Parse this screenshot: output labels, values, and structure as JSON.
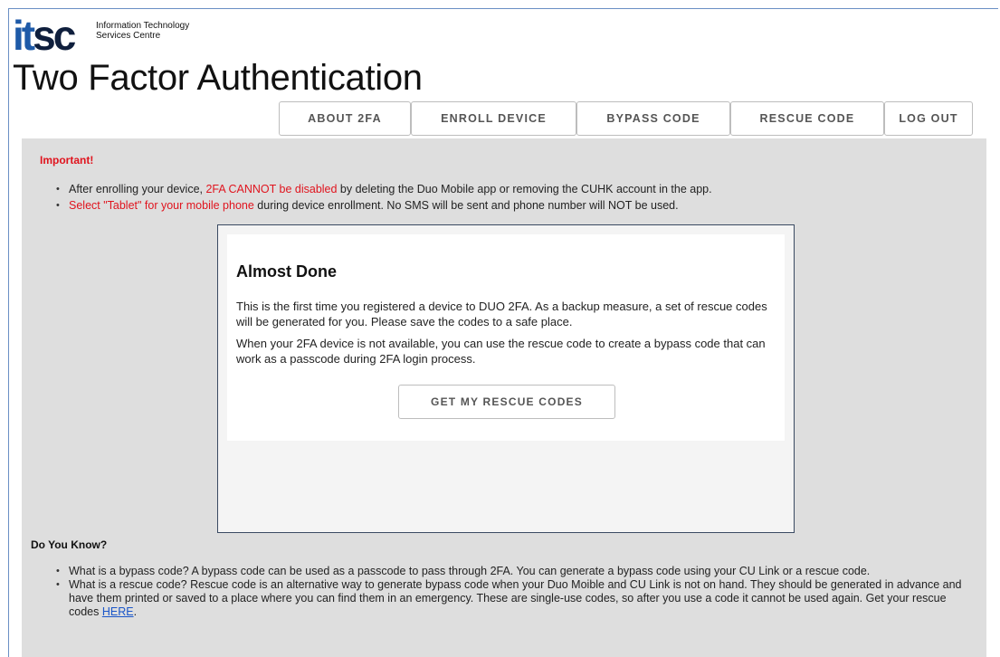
{
  "logo": {
    "mark": {
      "i": "i",
      "t": "t",
      "sc": "sc"
    },
    "line1": "Information Technology",
    "line2": "Services Centre"
  },
  "page_title": "Two Factor Authentication",
  "nav": [
    {
      "label": "ABOUT 2FA"
    },
    {
      "label": "ENROLL DEVICE"
    },
    {
      "label": "BYPASS CODE"
    },
    {
      "label": "RESCUE CODE"
    },
    {
      "label": "LOG OUT"
    }
  ],
  "important": {
    "heading": "Important!",
    "item1": {
      "pre": "After enrolling your device, ",
      "red": "2FA CANNOT be disabled",
      "post": " by deleting the Duo Mobile app or removing the CUHK account in the app."
    },
    "item2": {
      "red": "Select \"Tablet\" for your mobile phone",
      "post": " during device enrollment. No SMS will be sent and phone number will NOT be used."
    }
  },
  "modal": {
    "title": "Almost Done",
    "p1": "This is the first time you registered a device to DUO 2FA. As a backup measure, a set of rescue codes will be generated for you. Please save the codes to a safe place.",
    "p2": "When your 2FA device is not available, you can use the rescue code to create a bypass code that can work as a passcode during 2FA login process.",
    "button": "GET MY RESCUE CODES"
  },
  "do_you_know": {
    "heading": "Do You Know?",
    "item1": "What is a bypass code? A bypass code can be used as a passcode to pass through 2FA. You can generate a bypass code using your CU Link or a rescue code.",
    "item2_pre": "What is a rescue code? Rescue code is an alternative way to generate bypass code when your Duo Moible and CU Link is not on hand. They should be generated in advance and have them printed or saved to a place where you can find them in an emergency. These are single-use codes, so after you use a code it cannot be used again. Get your rescue codes ",
    "item2_link": "HERE",
    "item2_post": "."
  },
  "colors": {
    "accent_red": "#e0141e",
    "link_blue": "#1a56c9",
    "logo_blue": "#1e5aa8",
    "content_bg": "#dedede"
  }
}
